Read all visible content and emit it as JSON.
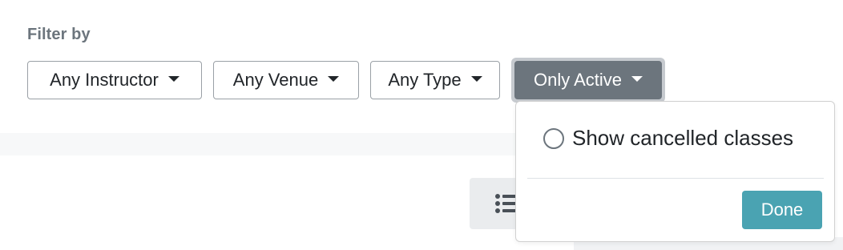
{
  "filters": {
    "heading": "Filter by",
    "instructor": {
      "label": "Any Instructor"
    },
    "venue": {
      "label": "Any Venue"
    },
    "type": {
      "label": "Any Type"
    },
    "status": {
      "label": "Only Active"
    }
  },
  "status_menu": {
    "option_label": "Show cancelled classes",
    "option_checked": false,
    "done_label": "Done"
  },
  "view_toggle": {
    "icon": "list-icon"
  },
  "colors": {
    "heading": "#6c757d",
    "active_button": "#6c757d",
    "done_button": "#4aa3b2"
  }
}
